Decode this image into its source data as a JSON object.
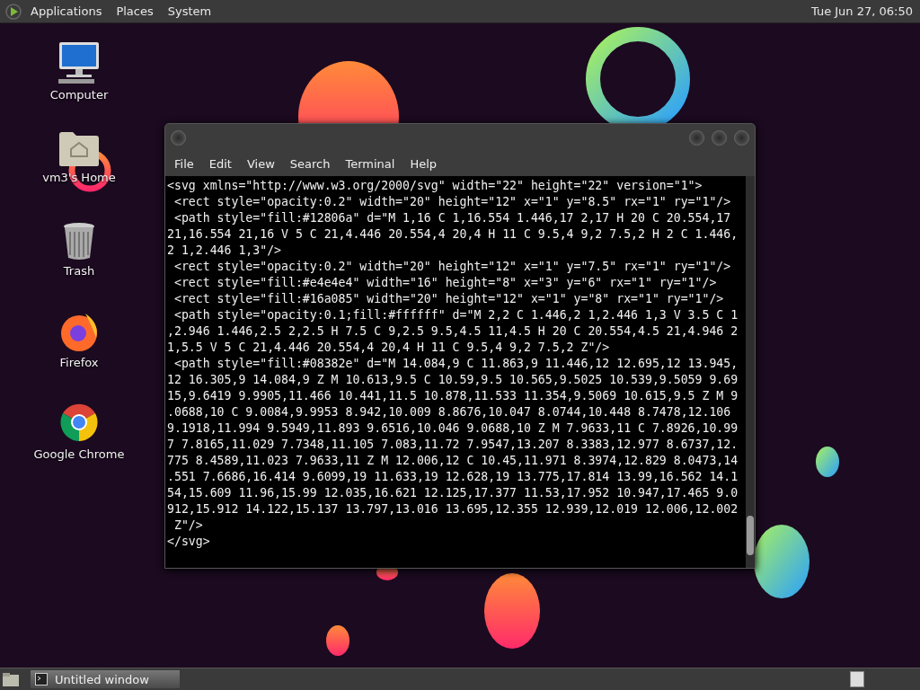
{
  "top_panel": {
    "menus": [
      "Applications",
      "Places",
      "System"
    ],
    "clock": "Tue Jun 27, 06:50"
  },
  "desktop_icons": [
    {
      "kind": "computer",
      "label": "Computer"
    },
    {
      "kind": "home",
      "label": "vm3's Home"
    },
    {
      "kind": "trash",
      "label": "Trash"
    },
    {
      "kind": "firefox",
      "label": "Firefox"
    },
    {
      "kind": "chrome",
      "label": "Google Chrome"
    }
  ],
  "terminal": {
    "menu": [
      "File",
      "Edit",
      "View",
      "Search",
      "Terminal",
      "Help"
    ],
    "lines": [
      "<svg xmlns=\"http://www.w3.org/2000/svg\" width=\"22\" height=\"22\" version=\"1\">",
      " <rect style=\"opacity:0.2\" width=\"20\" height=\"12\" x=\"1\" y=\"8.5\" rx=\"1\" ry=\"1\"/>",
      " <path style=\"fill:#12806a\" d=\"M 1,16 C 1,16.554 1.446,17 2,17 H 20 C 20.554,17",
      "21,16.554 21,16 V 5 C 21,4.446 20.554,4 20,4 H 11 C 9.5,4 9,2 7.5,2 H 2 C 1.446,",
      "2 1,2.446 1,3\"/>",
      " <rect style=\"opacity:0.2\" width=\"20\" height=\"12\" x=\"1\" y=\"7.5\" rx=\"1\" ry=\"1\"/>",
      " <rect style=\"fill:#e4e4e4\" width=\"16\" height=\"8\" x=\"3\" y=\"6\" rx=\"1\" ry=\"1\"/>",
      " <rect style=\"fill:#16a085\" width=\"20\" height=\"12\" x=\"1\" y=\"8\" rx=\"1\" ry=\"1\"/>",
      " <path style=\"opacity:0.1;fill:#ffffff\" d=\"M 2,2 C 1.446,2 1,2.446 1,3 V 3.5 C 1",
      ",2.946 1.446,2.5 2,2.5 H 7.5 C 9,2.5 9.5,4.5 11,4.5 H 20 C 20.554,4.5 21,4.946 2",
      "1,5.5 V 5 C 21,4.446 20.554,4 20,4 H 11 C 9.5,4 9,2 7.5,2 Z\"/>",
      " <path style=\"fill:#08382e\" d=\"M 14.084,9 C 11.863,9 11.446,12 12.695,12 13.945,",
      "12 16.305,9 14.084,9 Z M 10.613,9.5 C 10.59,9.5 10.565,9.5025 10.539,9.5059 9.69",
      "15,9.6419 9.9905,11.466 10.441,11.5 10.878,11.533 11.354,9.5069 10.615,9.5 Z M 9",
      ".0688,10 C 9.0084,9.9953 8.942,10.009 8.8676,10.047 8.0744,10.448 8.7478,12.106",
      "9.1918,11.994 9.5949,11.893 9.6516,10.046 9.0688,10 Z M 7.9633,11 C 7.8926,10.99",
      "7 7.8165,11.029 7.7348,11.105 7.083,11.72 7.9547,13.207 8.3383,12.977 8.6737,12.",
      "775 8.4589,11.023 7.9633,11 Z M 12.006,12 C 10.45,11.971 8.3974,12.829 8.0473,14",
      ".551 7.6686,16.414 9.6099,19 11.633,19 12.628,19 13.775,17.814 13.99,16.562 14.1",
      "54,15.609 11.96,15.99 12.035,16.621 12.125,17.377 11.53,17.952 10.947,17.465 9.0",
      "912,15.912 14.122,15.137 13.797,13.016 13.695,12.355 12.939,12.019 12.006,12.002",
      " Z\"/>",
      "</svg>"
    ]
  },
  "taskbar": {
    "windows": [
      {
        "label": "Untitled window"
      }
    ]
  }
}
